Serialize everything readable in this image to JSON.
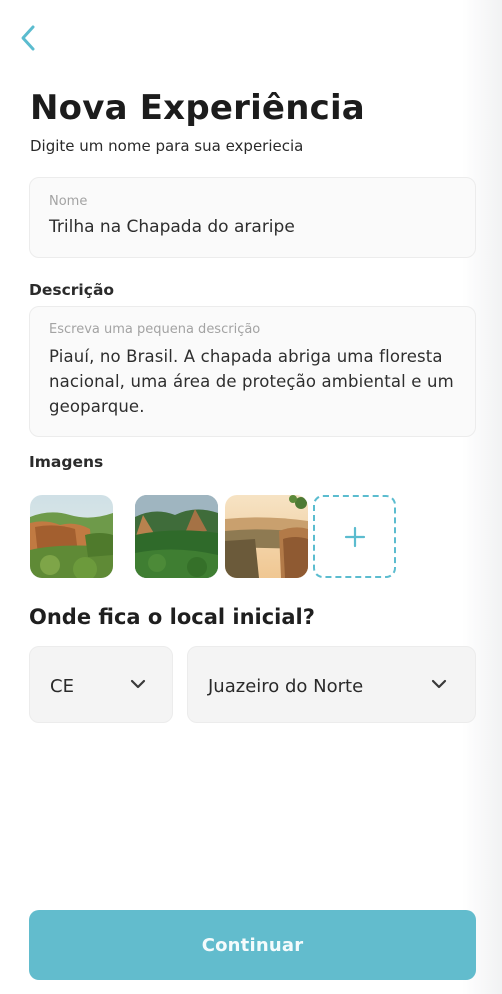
{
  "header": {
    "back_icon": "chevron-left-icon",
    "title": "Nova Experiência",
    "subtitle": "Digite um nome para sua experiecia"
  },
  "name_field": {
    "label": "Nome",
    "value": "Trilha na Chapada do araripe"
  },
  "description": {
    "section_label": "Descrição",
    "placeholder": "Escreva uma pequena descrição",
    "value": "Piauí, no Brasil. A chapada abriga uma floresta nacional, uma área de proteção ambiental e um geoparque."
  },
  "images": {
    "section_label": "Imagens",
    "items": [
      "cliff-forest-photo",
      "green-canyon-photo",
      "plateau-sunset-photo"
    ],
    "add_icon": "plus-icon"
  },
  "location": {
    "question": "Onde fica o local inicial?",
    "state": "CE",
    "city": "Juazeiro do Norte",
    "dropdown_icon": "chevron-down-icon"
  },
  "footer": {
    "continue_label": "Continuar"
  },
  "colors": {
    "accent": "#62bccd",
    "back_arrow": "#5bbccf",
    "field_bg": "#fafafa"
  }
}
